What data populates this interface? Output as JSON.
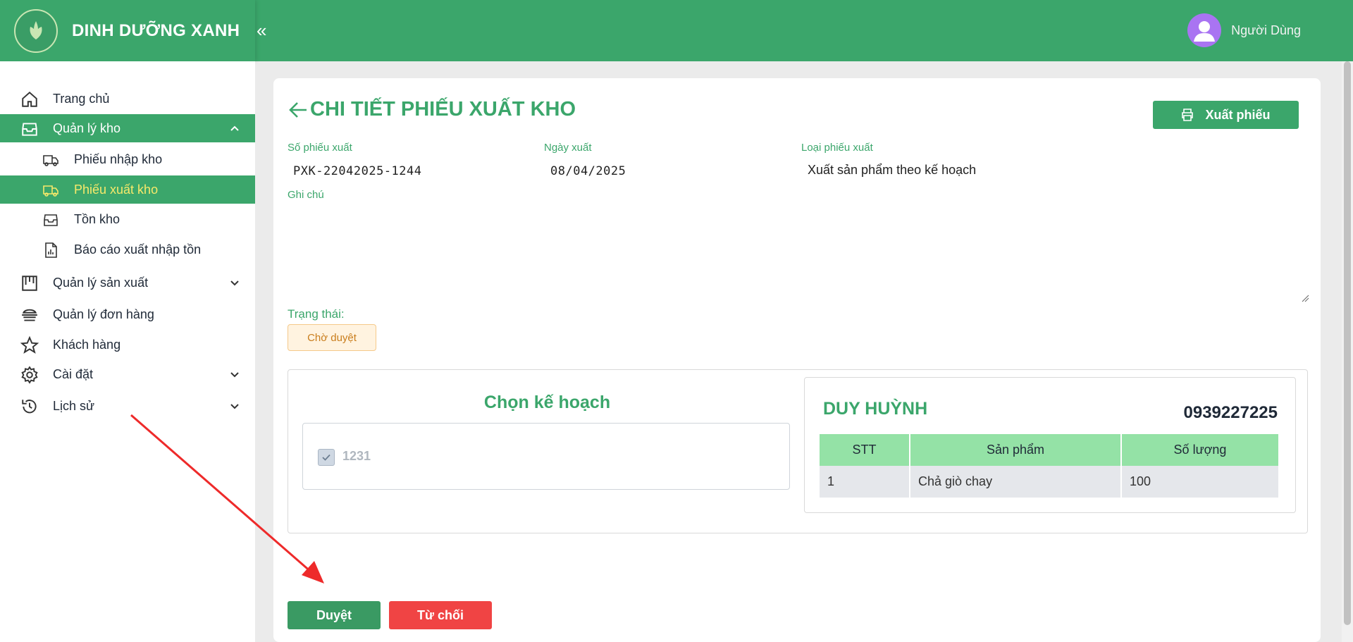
{
  "header": {
    "brand_name": "DINH DƯỠNG XANH",
    "collapse_icon": "chevrons-left-icon",
    "user_name": "Người Dùng",
    "colors": {
      "primary": "#3ba66b",
      "avatar": "#a974f2"
    }
  },
  "sidebar": {
    "items": [
      {
        "label": "Trang chủ",
        "icon": "home-icon"
      },
      {
        "label": "Quản lý kho",
        "icon": "inbox-icon",
        "active": true,
        "expanded": true
      },
      {
        "label": "Phiếu nhập kho",
        "icon": "truck-icon"
      },
      {
        "label": "Phiếu xuất kho",
        "icon": "truck-icon",
        "active": true
      },
      {
        "label": "Tồn kho",
        "icon": "inbox-icon"
      },
      {
        "label": "Báo cáo xuất nhập tồn",
        "icon": "report-icon"
      },
      {
        "label": "Quản lý sản xuất",
        "icon": "factory-icon"
      },
      {
        "label": "Quản lý đơn hàng",
        "icon": "orders-icon"
      },
      {
        "label": "Khách hàng",
        "icon": "star-icon"
      },
      {
        "label": "Cài đặt",
        "icon": "gear-icon"
      },
      {
        "label": "Lịch sử",
        "icon": "history-icon"
      }
    ]
  },
  "page": {
    "title": "CHI TIẾT PHIẾU XUẤT KHO",
    "export_label": "Xuất phiếu",
    "fields": {
      "code_label": "Số phiếu xuất",
      "code_value": "PXK-22042025-1244",
      "date_label": "Ngày xuất",
      "date_value": "08/04/2025",
      "type_label": "Loại phiếu xuất",
      "type_value": "Xuất sản phẩm theo kế hoạch",
      "note_label": "Ghi chú",
      "note_value": ""
    },
    "status_label": "Trạng thái:",
    "status_value": "Chờ duyệt"
  },
  "plan": {
    "title": "Chọn kế hoạch",
    "items": [
      {
        "name": "1231",
        "checked": true,
        "disabled": true
      }
    ]
  },
  "customer": {
    "name": "DUY HUỲNH",
    "phone": "0939227225",
    "columns": [
      "STT",
      "Sản phẩm",
      "Số lượng"
    ],
    "rows": [
      {
        "stt": "1",
        "product": "Chả giò chay",
        "qty": "100"
      }
    ]
  },
  "actions": {
    "approve_label": "Duyệt",
    "reject_label": "Từ chối"
  }
}
